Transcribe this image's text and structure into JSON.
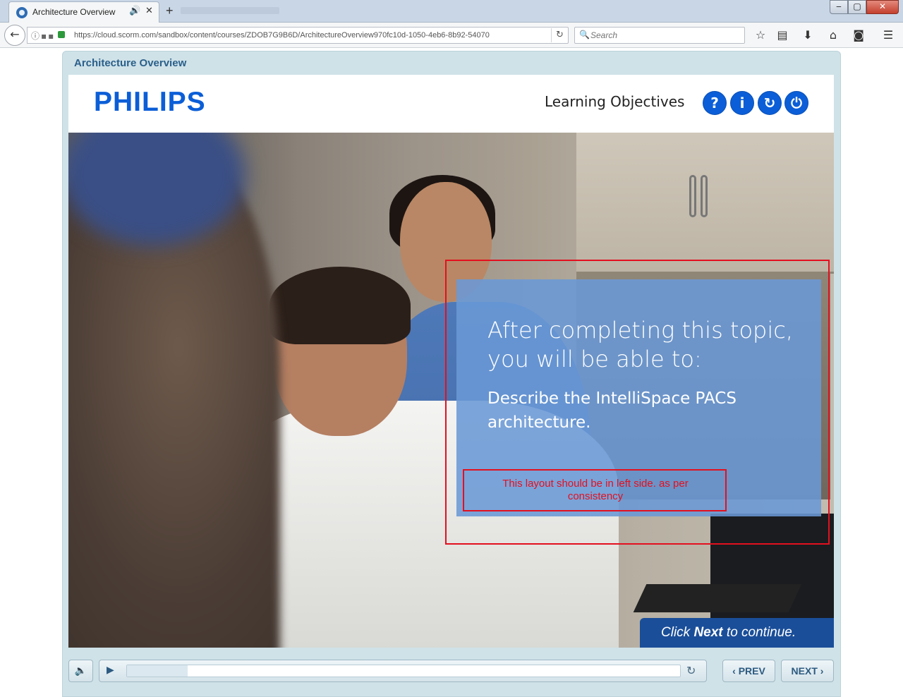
{
  "browser": {
    "tab": {
      "title": "Architecture Overview",
      "audio_icon": "speaker-icon",
      "close_icon": "close-icon"
    },
    "new_tab_label": "+",
    "window_controls": {
      "minimize": "‒",
      "maximize": "▢",
      "close": "✕"
    },
    "url": "https://cloud.scorm.com/sandbox/content/courses/ZDOB7G9B6D/ArchitectureOverview970fc10d-1050-4eb6-8b92-54070",
    "search": {
      "placeholder": "Search",
      "value": ""
    },
    "toolbar_icons": [
      "bookmark-star-icon",
      "reading-list-icon",
      "download-icon",
      "home-icon",
      "pocket-icon",
      "menu-icon"
    ]
  },
  "player": {
    "course_title": "Architecture Overview",
    "brand": "PHILIPS",
    "lesson_title": "Learning Objectives",
    "header_buttons": [
      {
        "name": "help-button",
        "glyph": "?"
      },
      {
        "name": "info-button",
        "glyph": "i"
      },
      {
        "name": "restart-button",
        "glyph": "↻"
      },
      {
        "name": "exit-button",
        "glyph": "⏻"
      }
    ],
    "content": {
      "heading": "After completing this topic, you will be able to:",
      "objective": "Describe the IntelliSpace PACS architecture."
    },
    "annotation": {
      "comment": "This layout should be in left side. as per consistency",
      "color": "#e3101f"
    },
    "continue": {
      "prefix": "Click ",
      "bold": "Next",
      "suffix": " to continue."
    },
    "controls": {
      "mute_glyph": "🔈",
      "play_glyph": "▶",
      "replay_glyph": "↻",
      "prev_label": "PREV",
      "next_label": "NEXT",
      "progress": 0.11
    }
  },
  "colors": {
    "brand_blue": "#0b5ed7",
    "panel_blue": "#6a99d6",
    "continue_bar": "#1a4e99"
  }
}
